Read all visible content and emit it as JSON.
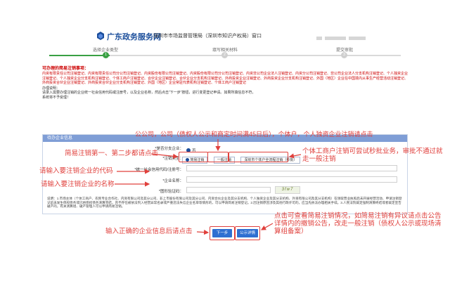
{
  "header": {
    "brand": "广东政务服务网",
    "department": "深圳市市场监督管理局（深圳市知识产权局）窗口"
  },
  "steps": [
    {
      "label": "选择企业类型",
      "number": "1",
      "completed": true
    },
    {
      "label": "填写相关材料",
      "number": "2",
      "completed": false
    },
    {
      "label": "提交审批",
      "number": "3",
      "completed": false
    }
  ],
  "notice": {
    "title": "可办理的简易注销事项：",
    "body": "内资有限责任公司注销登记、内资有限责任公司分公司注销登记、内资股份有限公司注销登记、内资股份有限公司分公司注销登记、内资非公司企业法人注销登记、内资分公司注销登记、非公司企业法人分支机构注销登记、个人独资企业注销登记、个人独资企业分支机构注销登记、个体工商户注销登记、合伙企业注销登记、合伙企业分支机构注销登记、外商投资企业注销登记、外商投资企业分支机构注销登记、外国（地区）企业在中国境内从事生产经营活动注销登记、外商投资合伙企业注销登记、外商投资合伙企业分支机构注销登记、外国（地区）企业常驻代表机构注销登记、个体工商户注销登记",
    "foot_title": "办理说明：",
    "foot_line1": "请录入需要办理注销的企业统一社会信用代码或注册号，以及企业名称，然后点击“下一步”按钮，进行变更登记申请。如果所填信息不符，",
    "foot_line2": "系统将不予受理！"
  },
  "form": {
    "panel_title": "待办企业信息",
    "fields": {
      "multi_store_label": "*是否分支企业：",
      "multi_store_option": "否",
      "cancel_type_label": "*注销类型：",
      "cancel_type_options": [
        "简易注销",
        "一般注销",
        "深圳市个体户全流程注销（秒批）"
      ],
      "credit_code_label": "*统一社会信用代码/注册号：",
      "credit_code_value": "",
      "company_name_label": "*企业名称：",
      "company_name_value": "",
      "captcha_label": "*图形验证码：",
      "captcha_value": "",
      "captcha_image_text": "3fw7"
    },
    "note": "说明：1.市场主体（个体工商户、农民专业合作社、内资有限公司及其分公司、非上市股份有限公司及其分公司、内资合伙企业及其分支机构、个人独资企业及其分支机构、外资有限公司及其分支机构）在领取营业执照后未开展经营活动、申请注销登记前未发生债权债务或已将债权债务清算完结，且不存在被依法列入经营异常名录或严重违法失信企业名单等情形的，可以申请简易注销登记。2.因注销原因涉及其他行政许可的，应当先依法办理相关手续。3.人民法院裁定强制清算终结或者裁定宣告破产的，有关清算组、破产管理人可以申请简易注销。",
    "next_button": "下一步",
    "announce_button": "公示详情"
  },
  "annotations": {
    "company_cancel": "公公司，公司（债权人公示和商定时间满45日后），个体户，个人独资企业注销请点击",
    "simple_cancel_steps": "简易注销第一、第二步都请点击",
    "sole_proprietor": "个体工商户注销可尝试秒批业务，审批不通过就走一般注销",
    "enter_code": "请输入要注销企业的代码",
    "enter_name": "请输入要注销企业的名称",
    "announce_hint": "点击可查看简易注销情况，如简易注销有异议请点击公告详情内的撤销公告，改走一般注销（债权人公示或现场清算组备案）",
    "enter_correct": "输入正确的企业信息后请点击"
  },
  "colors": {
    "brand_blue": "#1b4e9b",
    "step_green": "#39a043",
    "annotation_red": "#e0403c",
    "button_blue": "#2f6fd1",
    "panel_head": "#7f9ed6"
  }
}
